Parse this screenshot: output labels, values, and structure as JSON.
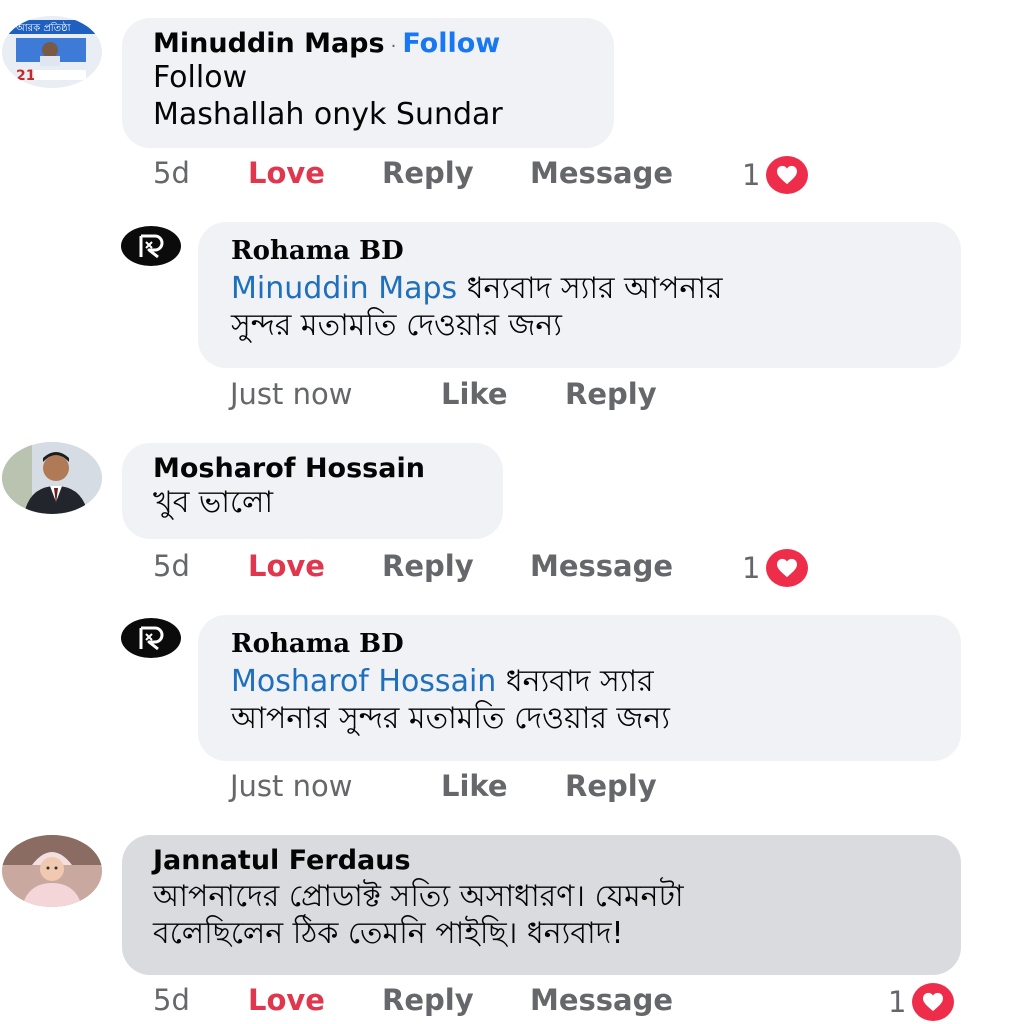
{
  "comments": [
    {
      "author": "Minuddin Maps",
      "follow_label": "Follow",
      "separator": "·",
      "lines": [
        "Follow",
        "Mashallah onyk Sundar"
      ],
      "time": "5d",
      "love": "Love",
      "reply": "Reply",
      "message": "Message",
      "reaction_count": "1",
      "reply_item": {
        "author": "Rohama BD",
        "mention": "Minuddin Maps",
        "line1_rest": " ধন্যবাদ স্যার আপনার",
        "line2": "সুন্দর মতামতি দেওয়ার জন্য",
        "time": "Just now",
        "like": "Like",
        "reply": "Reply"
      }
    },
    {
      "author": "Mosharof Hossain",
      "lines": [
        "খুব ভালো"
      ],
      "time": "5d",
      "love": "Love",
      "reply": "Reply",
      "message": "Message",
      "reaction_count": "1",
      "reply_item": {
        "author": "Rohama BD",
        "mention": "Mosharof Hossain",
        "line1_rest": " ধন্যবাদ স্যার",
        "line2": "আপনার সুন্দর মতামতি দেওয়ার জন্য",
        "time": "Just now",
        "like": "Like",
        "reply": "Reply"
      }
    },
    {
      "author": "Jannatul Ferdaus",
      "lines": [
        "আপনাদের প্রোডাক্ট সত্যি অসাধারণ। যেমনটা",
        "বলেছিলেন ঠিক তেমনি পাইছি। ধন্যবাদ!"
      ],
      "time": "5d",
      "love": "Love",
      "reply": "Reply",
      "message": "Message",
      "reaction_count": "1"
    }
  ],
  "colors": {
    "bubble": "#f0f2f5",
    "bubble_selected": "#d9dbdf",
    "love": "#e0364e",
    "mention": "#1e6fbd",
    "follow": "#1877f2",
    "heart": "#ee2d4b"
  }
}
